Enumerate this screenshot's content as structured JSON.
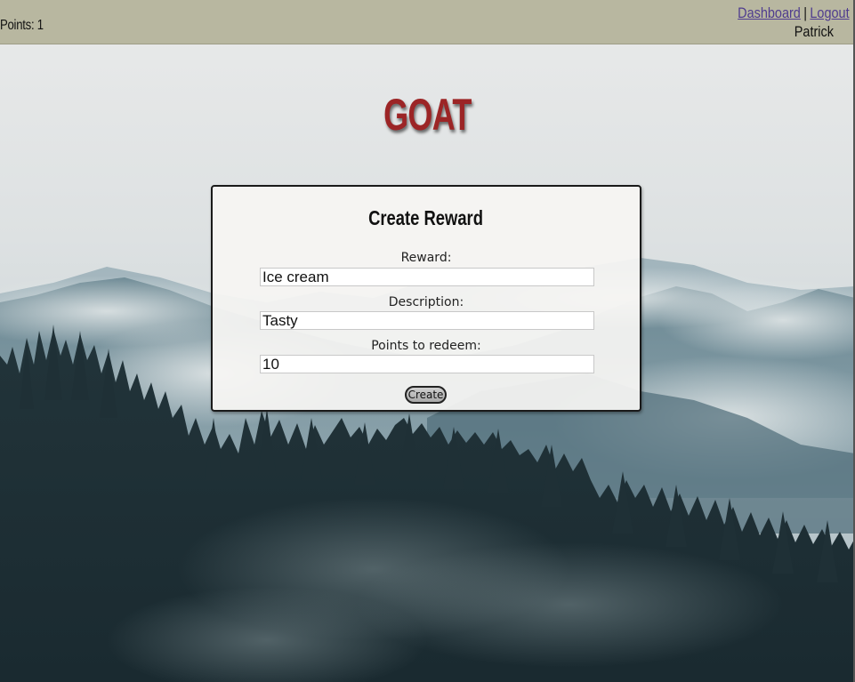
{
  "header": {
    "points_label": "Points: 1",
    "nav": {
      "dashboard_link": "Dashboard",
      "separator": "|",
      "logout_link": "Logout"
    },
    "username": "Patrick"
  },
  "logo": {
    "text": "GOAT",
    "color": "#9c2526"
  },
  "form": {
    "title": "Create Reward",
    "fields": [
      {
        "label": "Reward:",
        "value": "Ice cream"
      },
      {
        "label": "Description:",
        "value": "Tasty"
      },
      {
        "label": "Points to redeem:",
        "value": "10"
      }
    ],
    "submit_label": "Create"
  },
  "theme": {
    "header_bg": "#b8b7a0",
    "link_color": "#4f3c8f"
  }
}
